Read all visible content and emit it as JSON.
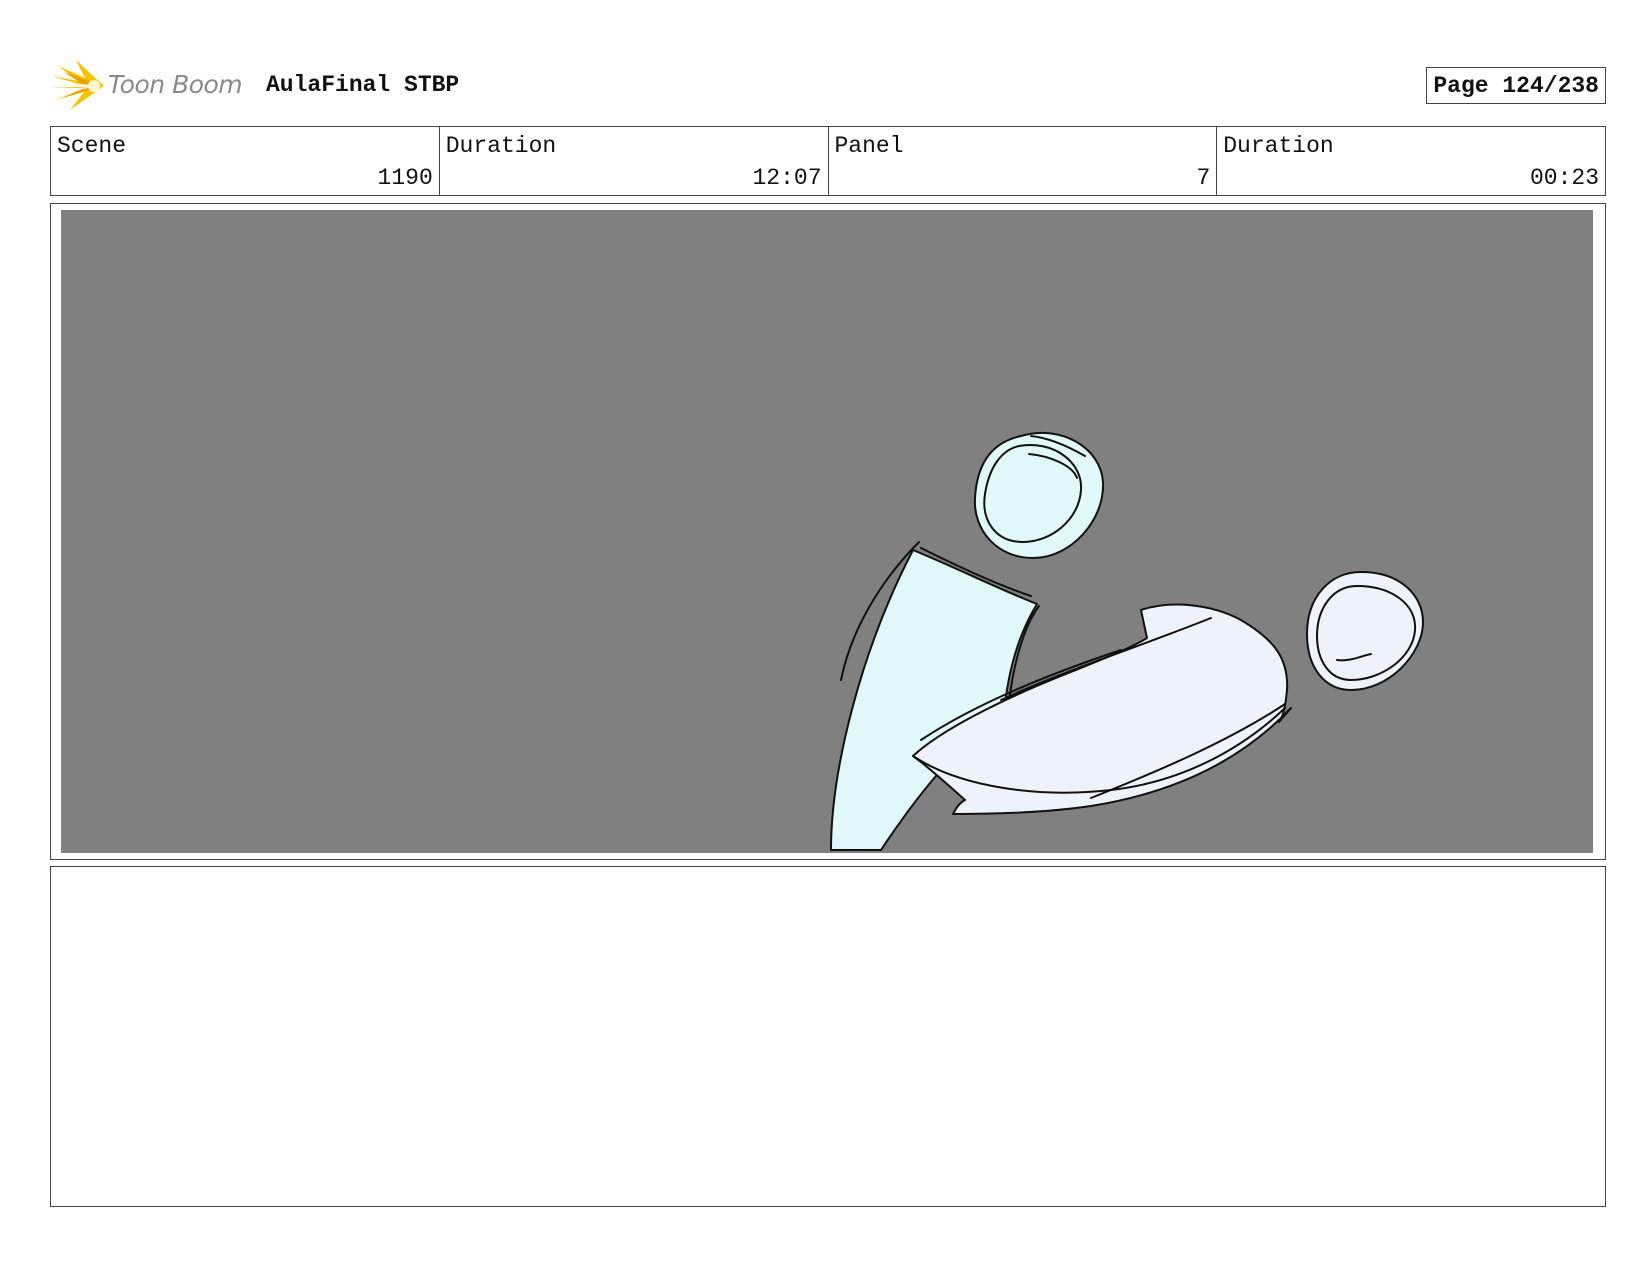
{
  "header": {
    "logo_text": "Toon Boom",
    "project_title": "AulaFinal STBP",
    "page_label": "Page 124/238"
  },
  "info": {
    "scene_label": "Scene",
    "scene_value": "1190",
    "scene_duration_label": "Duration",
    "scene_duration_value": "12:07",
    "panel_label": "Panel",
    "panel_value": "7",
    "panel_duration_label": "Duration",
    "panel_duration_value": "00:23"
  },
  "colors": {
    "panel_background": "#808080",
    "figure_left_fill": "#e0f8f8",
    "figure_right_fill": "#eef2fa",
    "logo_yellow": "#f5c400"
  }
}
